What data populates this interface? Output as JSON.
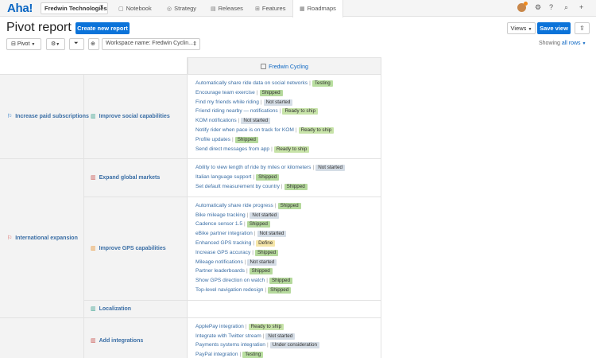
{
  "app": {
    "logo": "Aha!",
    "workspace": "Fredwin Technologies",
    "tabs": [
      {
        "label": "Notebook",
        "icon": "notebook-icon",
        "glyph": "▢"
      },
      {
        "label": "Strategy",
        "icon": "strategy-icon",
        "glyph": "◎"
      },
      {
        "label": "Releases",
        "icon": "releases-icon",
        "glyph": "▤"
      },
      {
        "label": "Features",
        "icon": "features-icon",
        "glyph": "⊞"
      },
      {
        "label": "Roadmaps",
        "icon": "roadmaps-icon",
        "glyph": "▦",
        "active": true
      }
    ],
    "right_icons": [
      "avatar",
      "settings-icon",
      "help-icon",
      "search-icon",
      "add-icon"
    ]
  },
  "header": {
    "title": "Pivot report",
    "create_button": "Create new report",
    "views_button": "Views",
    "save_button": "Save view"
  },
  "toolbar": {
    "pivot_label": "Pivot",
    "filter_text": "Workspace name: Fredwin Cyclin...",
    "showing_prefix": "Showing",
    "showing_link": "all rows"
  },
  "grid": {
    "column_header": "Fredwin Cycling",
    "groups": [
      {
        "goal": "Increase paid subscriptions",
        "initiatives": [
          {
            "name": "Improve social capabilities",
            "features": [
              {
                "name": "Automatically share ride data on social networks",
                "status": "Testing"
              },
              {
                "name": "Encourage team exercise",
                "status": "Shipped"
              },
              {
                "name": "Find my friends while riding",
                "status": "Not started"
              },
              {
                "name": "Friend riding nearby — notifications",
                "status": "Ready to ship"
              },
              {
                "name": "KOM notifications",
                "status": "Not started"
              },
              {
                "name": "Notify rider when pace is on track for KOM",
                "status": "Ready to ship"
              },
              {
                "name": "Profile updates",
                "status": "Shipped"
              },
              {
                "name": "Send direct messages from app",
                "status": "Ready to ship"
              }
            ]
          }
        ]
      },
      {
        "goal": "International expansion",
        "initiatives": [
          {
            "name": "Expand global markets",
            "features": [
              {
                "name": "Ability to view length of ride by miles or kilometers",
                "status": "Not started"
              },
              {
                "name": "Italian language support",
                "status": "Shipped"
              },
              {
                "name": "Set default measurement by country",
                "status": "Shipped"
              }
            ]
          },
          {
            "name": "Improve GPS capabilities",
            "features": [
              {
                "name": "Automatically share ride progress",
                "status": "Shipped"
              },
              {
                "name": "Bike mileage tracking",
                "status": "Not started"
              },
              {
                "name": "Cadence sensor 1.5",
                "status": "Shipped"
              },
              {
                "name": "eBike partner integration",
                "status": "Not started"
              },
              {
                "name": "Enhanced GPS tracking",
                "status": "Define"
              },
              {
                "name": "Increase GPS accuracy",
                "status": "Shipped"
              },
              {
                "name": "Mileage notifications",
                "status": "Not started"
              },
              {
                "name": "Partner leaderboards",
                "status": "Shipped"
              },
              {
                "name": "Show GPS direction on watch",
                "status": "Shipped"
              },
              {
                "name": "Top-level navigation redesign",
                "status": "Shipped"
              }
            ]
          },
          {
            "name": "Localization",
            "features": []
          }
        ]
      },
      {
        "goal": "",
        "initiatives": [
          {
            "name": "Add integrations",
            "features": [
              {
                "name": "ApplePay integration",
                "status": "Ready to ship"
              },
              {
                "name": "Integrate with Twitter stream",
                "status": "Not started"
              },
              {
                "name": "Payments systems integration",
                "status": "Under consideration"
              },
              {
                "name": "PayPal integration",
                "status": "Testing"
              }
            ]
          }
        ]
      }
    ]
  },
  "colors": {
    "accent": "#0b73d9",
    "link": "#3a6ea5",
    "shipped": "#b5d99c",
    "not_started": "#d5dde6",
    "define": "#f6e6a8"
  }
}
